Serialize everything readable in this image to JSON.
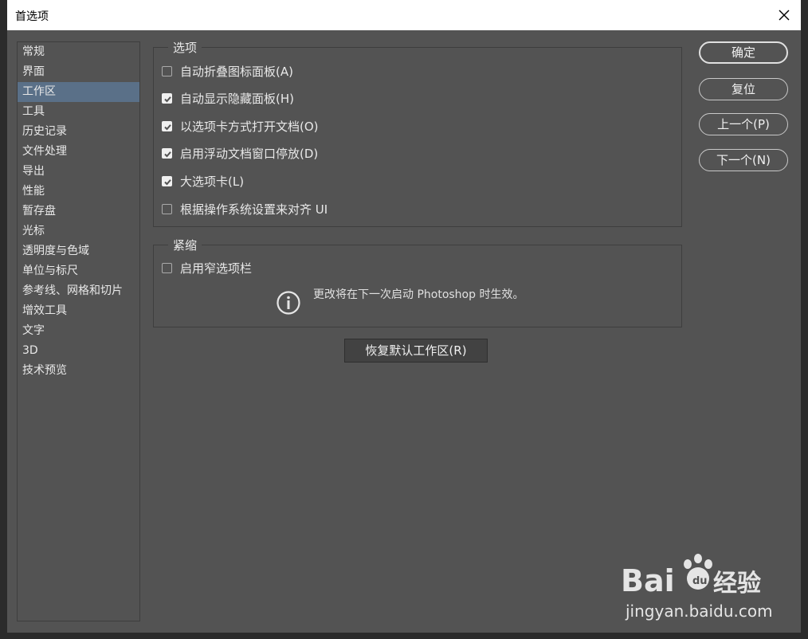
{
  "dialog": {
    "title": "首选项"
  },
  "sidebar": {
    "items": [
      {
        "label": "常规"
      },
      {
        "label": "界面"
      },
      {
        "label": "工作区",
        "active": true
      },
      {
        "label": "工具"
      },
      {
        "label": "历史记录"
      },
      {
        "label": "文件处理"
      },
      {
        "label": "导出"
      },
      {
        "label": "性能"
      },
      {
        "label": "暂存盘"
      },
      {
        "label": "光标"
      },
      {
        "label": "透明度与色域"
      },
      {
        "label": "单位与标尺"
      },
      {
        "label": "参考线、网格和切片"
      },
      {
        "label": "增效工具"
      },
      {
        "label": "文字"
      },
      {
        "label": "3D"
      },
      {
        "label": "技术预览"
      }
    ]
  },
  "options_group": {
    "legend": "选项",
    "items": [
      {
        "label": "自动折叠图标面板(A)",
        "checked": false
      },
      {
        "label": "自动显示隐藏面板(H)",
        "checked": true
      },
      {
        "label": "以选项卡方式打开文档(O)",
        "checked": true
      },
      {
        "label": "启用浮动文档窗口停放(D)",
        "checked": true
      },
      {
        "label": "大选项卡(L)",
        "checked": true
      },
      {
        "label": "根据操作系统设置来对齐 UI",
        "checked": false
      }
    ]
  },
  "compact_group": {
    "legend": "紧缩",
    "items": [
      {
        "label": "启用窄选项栏",
        "checked": false
      }
    ],
    "info_text": "更改将在下一次启动 Photoshop 时生效。"
  },
  "reset_button": "恢复默认工作区(R)",
  "actions": {
    "ok": "确定",
    "reset": "复位",
    "prev": "上一个(P)",
    "next": "下一个(N)"
  },
  "watermark": {
    "brand": "Bai",
    "brand2": "经验",
    "url": "jingyan.baidu.com"
  }
}
